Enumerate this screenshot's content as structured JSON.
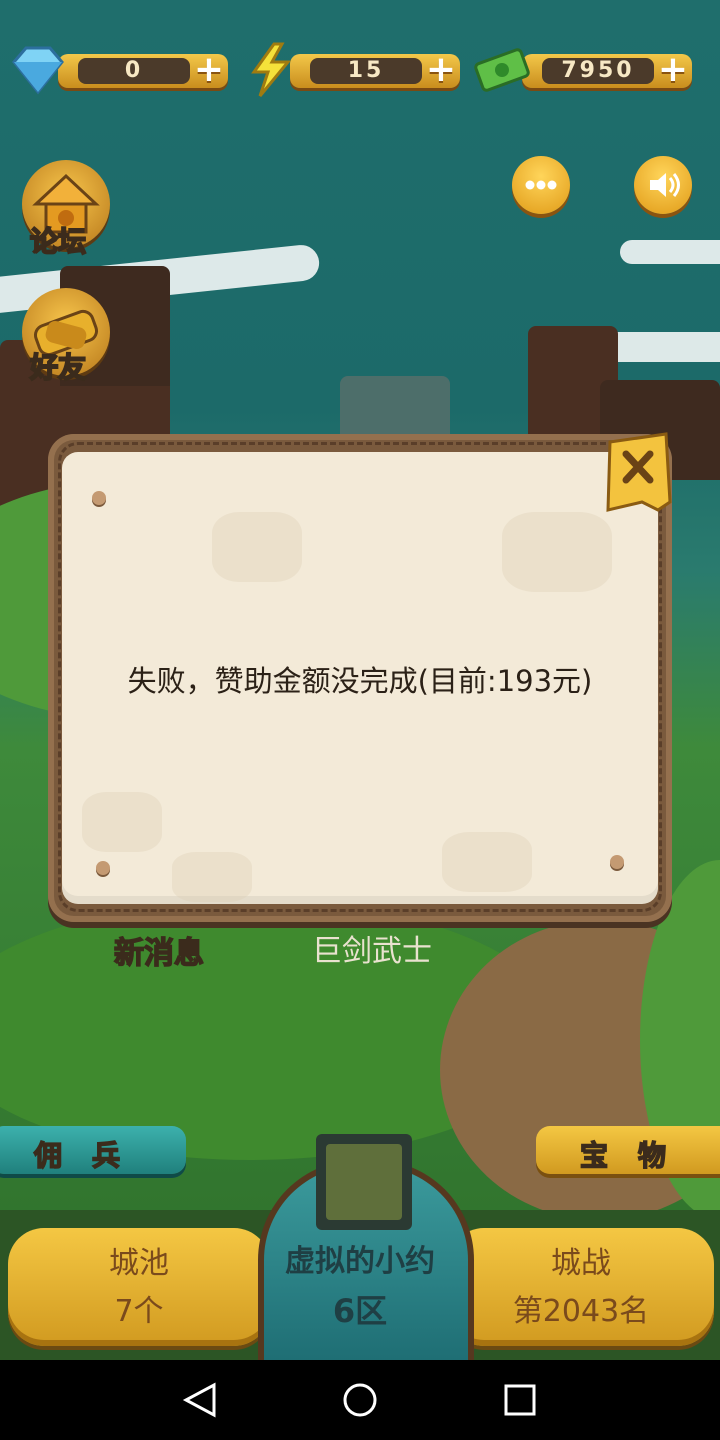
{
  "resources": {
    "gems": "0",
    "energy": "15",
    "cash": "7950"
  },
  "side_buttons": {
    "forum": "论坛",
    "friends": "好友"
  },
  "dialog": {
    "message": "失败，赞助金额没完成(目前:193元)",
    "close_icon": "close-x-icon"
  },
  "behind_dialog": {
    "news": "新消息",
    "hero_name": "巨剑武士"
  },
  "tabs": {
    "mercenary": "佣兵",
    "treasure": "宝物"
  },
  "bottom": {
    "city": {
      "label": "城池",
      "value": "7个"
    },
    "player": {
      "name": "虚拟的小约",
      "zone": "6区"
    },
    "battle": {
      "label": "城战",
      "value": "第2043名"
    }
  },
  "colors": {
    "gold": "#f4c743",
    "teal": "#2a8f93",
    "paper": "#f3ead8",
    "frame": "#7a5a3d"
  }
}
